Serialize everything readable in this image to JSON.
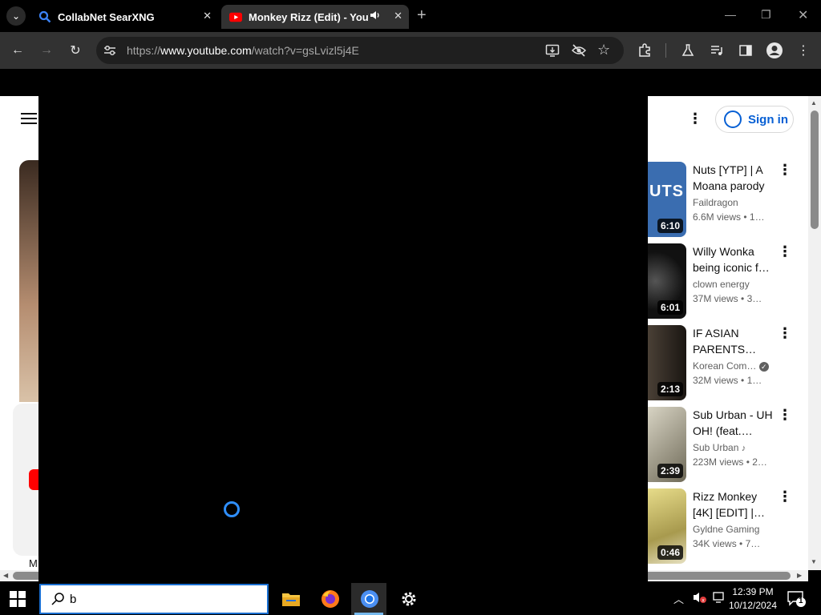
{
  "browser": {
    "tabs": [
      {
        "title": "CollabNet SearXNG",
        "favicon": "search-icon"
      },
      {
        "title": "Monkey Rizz (Edit) - YouTube",
        "favicon": "youtube-icon",
        "audio": true,
        "active": true
      }
    ],
    "url_prefix": "https://",
    "url_host": "www.youtube.com",
    "url_path": "/watch?v=gsLvizl5j4E"
  },
  "youtube": {
    "signin_label": "Sign in",
    "left_letter": "M",
    "recommendations": [
      {
        "title": "Nuts [YTP] | A Moana parody",
        "channel": "Faildragon",
        "views": "6.6M views",
        "age": "1…",
        "duration": "6:10",
        "thumb_color": "#3a6db0"
      },
      {
        "title": "Willy Wonka being iconic f…",
        "channel": "clown energy",
        "views": "37M views",
        "age": "3…",
        "duration": "6:01",
        "thumb_color": "#1b1b1b"
      },
      {
        "title": "IF ASIAN PARENTS…",
        "channel": "Korean Com…",
        "views": "32M views",
        "age": "1…",
        "duration": "2:13",
        "thumb_color": "#2b2620",
        "verified": true
      },
      {
        "title": "Sub Urban - UH OH! (feat.…",
        "channel": "Sub Urban",
        "views": "223M views",
        "age": "2…",
        "duration": "2:39",
        "thumb_color": "#8b8570",
        "music": true
      },
      {
        "title": "Rizz Monkey [4K] [EDIT] |…",
        "channel": "Gyldne Gaming",
        "views": "34K views",
        "age": "7…",
        "duration": "0:46",
        "thumb_color": "#c9bc6a"
      }
    ]
  },
  "taskbar": {
    "search_value": "b",
    "time": "12:39 PM",
    "date": "10/12/2024",
    "notification_count": "1"
  }
}
